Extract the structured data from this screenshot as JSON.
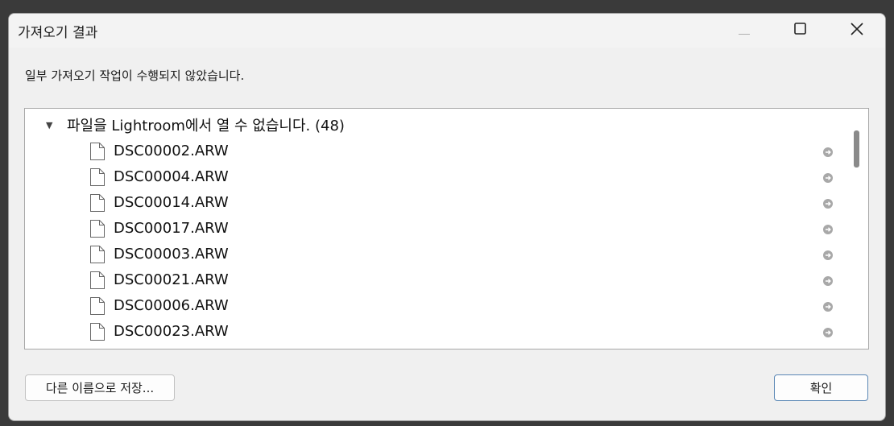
{
  "window": {
    "title": "가져오기 결과"
  },
  "message": "일부 가져오기 작업이 수행되지 않았습니다.",
  "tree": {
    "group_label": "파일을 Lightroom에서 열 수 없습니다. (48)",
    "files": [
      "DSC00002.ARW",
      "DSC00004.ARW",
      "DSC00014.ARW",
      "DSC00017.ARW",
      "DSC00003.ARW",
      "DSC00021.ARW",
      "DSC00006.ARW",
      "DSC00023.ARW"
    ]
  },
  "buttons": {
    "save_as": "다른 이름으로 저장...",
    "ok": "확인"
  }
}
